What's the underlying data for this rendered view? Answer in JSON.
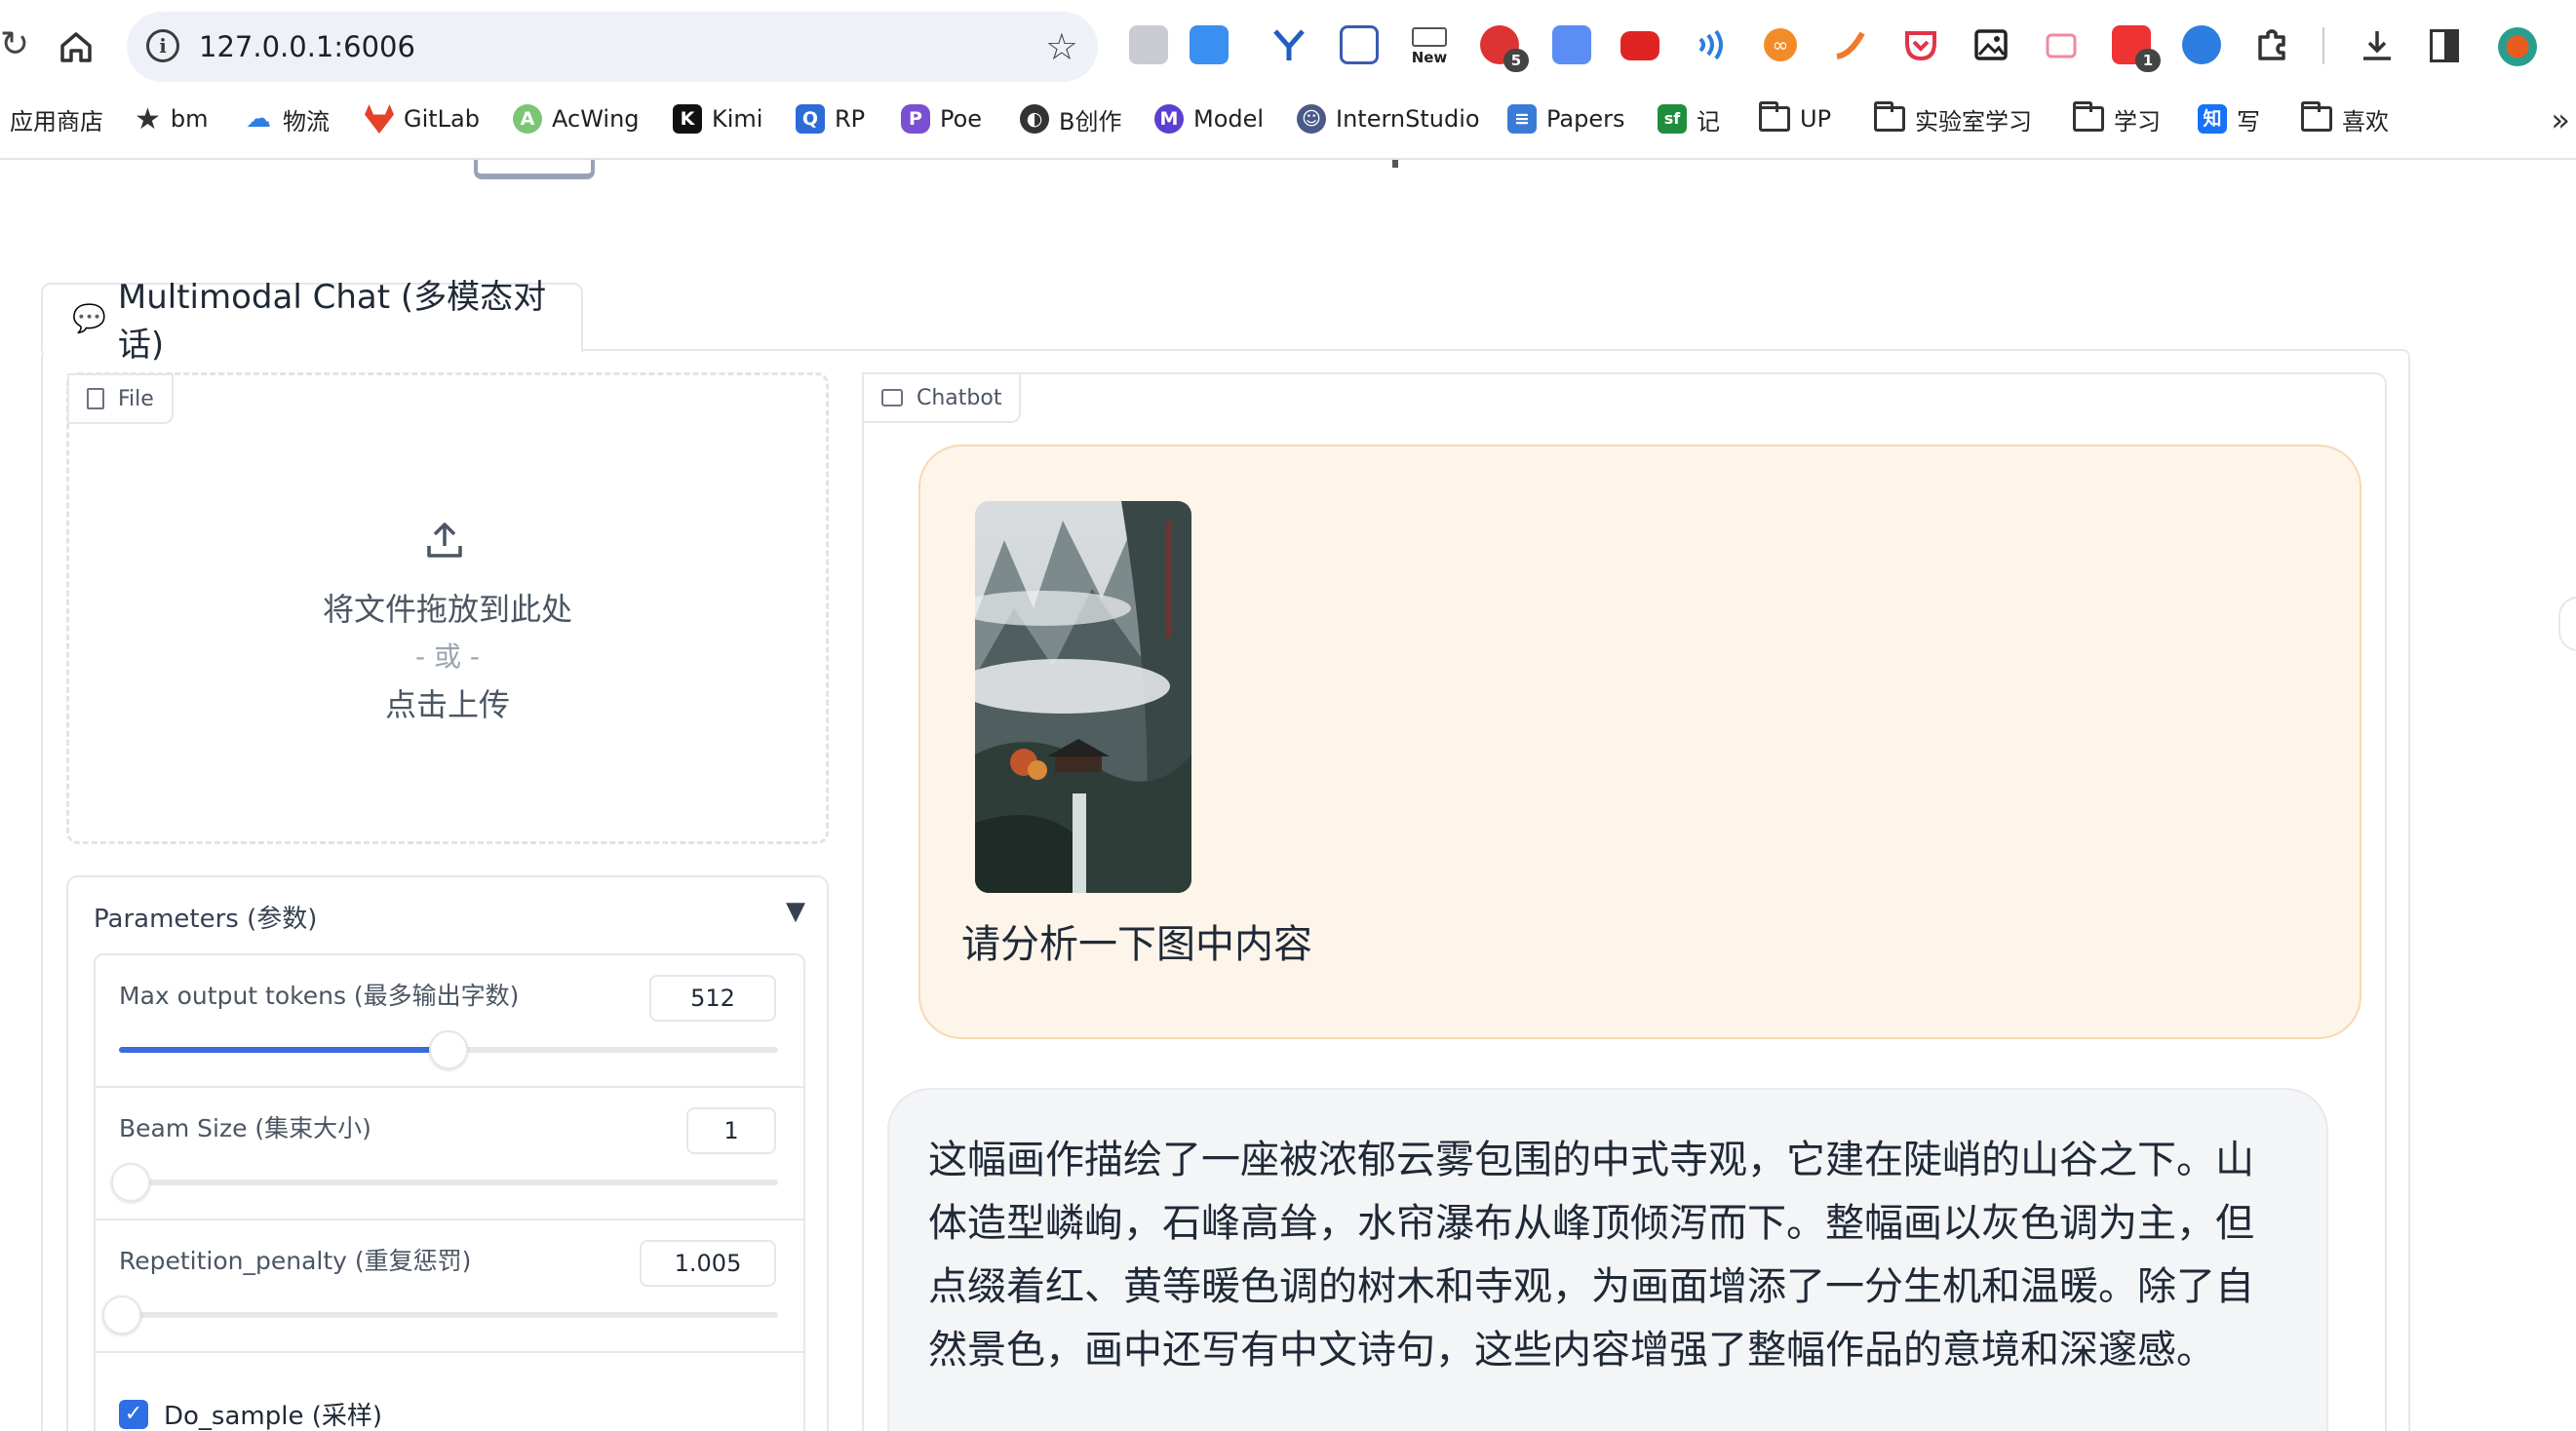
{
  "browser": {
    "url": "127.0.0.1:6006",
    "extension_new_label": "New",
    "extension_badges": [
      "5",
      "1"
    ],
    "bookmarks": [
      {
        "label": "应用商店",
        "icon": "apps-icon"
      },
      {
        "label": "bm",
        "icon": "star-icon"
      },
      {
        "label": "物流",
        "icon": "cloud-icon"
      },
      {
        "label": "GitLab",
        "icon": "gitlab-icon"
      },
      {
        "label": "AcWing",
        "icon": "acwing-icon"
      },
      {
        "label": "Kimi",
        "icon": "kimi-icon"
      },
      {
        "label": "RP",
        "icon": "rp-icon"
      },
      {
        "label": "Poe",
        "icon": "poe-icon"
      },
      {
        "label": "B创作",
        "icon": "bilibili-icon"
      },
      {
        "label": "Model",
        "icon": "model-icon"
      },
      {
        "label": "InternStudio",
        "icon": "internstudio-icon"
      },
      {
        "label": "Papers",
        "icon": "papers-icon"
      },
      {
        "label": "记",
        "icon": "sf-icon"
      },
      {
        "label": "UP",
        "icon": "folder-icon"
      },
      {
        "label": "实验室学习",
        "icon": "folder-icon"
      },
      {
        "label": "学习",
        "icon": "folder-icon"
      },
      {
        "label": "写",
        "icon": "zhihu-icon"
      },
      {
        "label": "喜欢",
        "icon": "folder-icon"
      }
    ],
    "sf_label": "sf",
    "zhihu_label": "知"
  },
  "tab": {
    "icon": "speech-bubble-icon",
    "label": "Multimodal Chat (多模态对话)"
  },
  "upload": {
    "label": "File",
    "drop_text": "将文件拖放到此处",
    "or_text": "- 或 -",
    "click_text": "点击上传"
  },
  "parameters": {
    "title": "Parameters (参数)",
    "expanded": true,
    "max_tokens": {
      "label": "Max output tokens (最多输出字数)",
      "value": "512",
      "min": 0,
      "max": 1024
    },
    "beam_size": {
      "label": "Beam Size (集束大小)",
      "value": "1",
      "min": 1,
      "max": 5
    },
    "repetition_penalty": {
      "label": "Repetition_penalty (重复惩罚)",
      "value": "1.005",
      "min": 1.0,
      "max": 2.0
    },
    "do_sample": {
      "label": "Do_sample (采样)",
      "checked": true
    }
  },
  "chatbot": {
    "label": "Chatbot",
    "messages": [
      {
        "role": "user",
        "image": "chinese-landscape-painting",
        "text": "请分析一下图中内容"
      },
      {
        "role": "bot",
        "text": "这幅画作描绘了一座被浓郁云雾包围的中式寺观，它建在陡峭的山谷之下。山体造型嶙峋，石峰高耸，水帘瀑布从峰顶倾泻而下。整幅画以灰色调为主，但点缀着红、黄等暖色调的树木和寺观，为画面增添了一分生机和温暖。除了自然景色，画中还写有中文诗句，这些内容增强了整幅作品的意境和深邃感。"
      }
    ]
  },
  "colors": {
    "accent": "#2f6fe4",
    "user_bubble": "#fdf4ea",
    "user_bubble_border": "#f9d9b0",
    "bot_bubble": "#f4f5f7"
  }
}
